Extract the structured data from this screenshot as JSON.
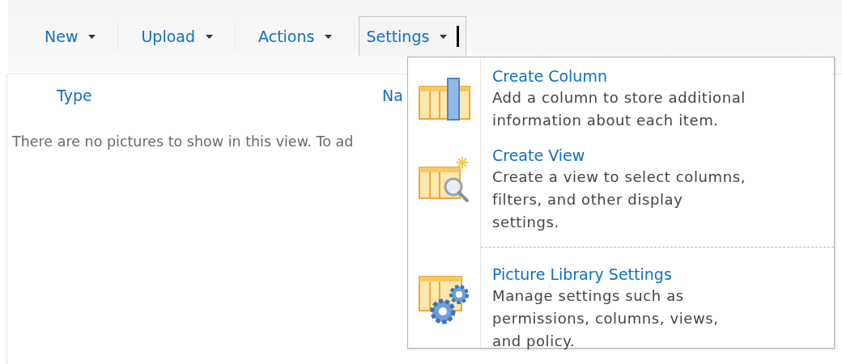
{
  "toolbar": {
    "menus": [
      {
        "label": "New",
        "selected": false
      },
      {
        "label": "Upload",
        "selected": false
      },
      {
        "label": "Actions",
        "selected": false
      },
      {
        "label": "Settings",
        "selected": true
      }
    ]
  },
  "table": {
    "columns": [
      "Type",
      "Na"
    ],
    "empty_message": "There are no pictures to show in this view. To ad"
  },
  "settings_menu": {
    "items": [
      {
        "kind": "column",
        "title": "Create Column",
        "description": "Add a column to store additional information about each item.",
        "separator_before": false
      },
      {
        "kind": "view",
        "title": "Create View",
        "description": "Create a view to select columns, filters, and other display settings.",
        "separator_before": false
      },
      {
        "kind": "settings",
        "title": "Picture Library Settings",
        "description": "Manage settings such as permissions, columns, views, and policy.",
        "separator_before": true
      }
    ]
  }
}
